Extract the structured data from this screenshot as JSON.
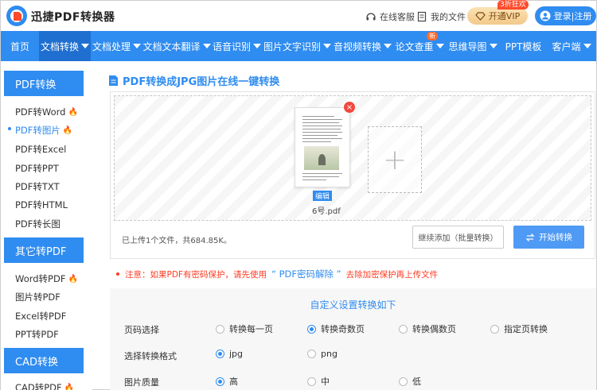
{
  "header": {
    "brand": "迅捷PDF转换器",
    "service_label": "在线客服",
    "files_label": "我的文件",
    "vip_label": "开通VIP",
    "vip_badge": "3折狂欢",
    "login_label": "登录|注册"
  },
  "nav": {
    "items": [
      {
        "label": "首页",
        "dropdown": false
      },
      {
        "label": "文档转换",
        "dropdown": true,
        "active": true
      },
      {
        "label": "文档处理",
        "dropdown": true
      },
      {
        "label": "文档文本翻译",
        "dropdown": true
      },
      {
        "label": "语音识别",
        "dropdown": true
      },
      {
        "label": "图片文字识别",
        "dropdown": true
      },
      {
        "label": "音视频转换",
        "dropdown": true
      },
      {
        "label": "论文查重",
        "dropdown": true,
        "badge": "新"
      },
      {
        "label": "思维导图",
        "dropdown": true
      },
      {
        "label": "PPT模板",
        "dropdown": false
      },
      {
        "label": "客户端",
        "dropdown": true
      }
    ]
  },
  "sidebar": {
    "section1": {
      "title": "PDF转换",
      "items": [
        {
          "label": "PDF转Word",
          "hot": true
        },
        {
          "label": "PDF转图片",
          "hot": true,
          "active": true
        },
        {
          "label": "PDF转Excel"
        },
        {
          "label": "PDF转PPT"
        },
        {
          "label": "PDF转TXT"
        },
        {
          "label": "PDF转HTML"
        },
        {
          "label": "PDF转长图"
        }
      ]
    },
    "section2": {
      "title": "其它转PDF",
      "items": [
        {
          "label": "Word转PDF",
          "hot": true
        },
        {
          "label": "图片转PDF"
        },
        {
          "label": "Excel转PDF"
        },
        {
          "label": "PPT转PDF"
        }
      ]
    },
    "section3": {
      "title": "CAD转换",
      "items": [
        {
          "label": "CAD转PDF",
          "hot": true
        }
      ]
    }
  },
  "main": {
    "title": "PDF转换成JPG图片在线一键转换",
    "file": {
      "name": "6号.pdf",
      "edit_label": "编辑",
      "close_glyph": "×"
    },
    "add_glyph": "+",
    "upload_info": "已上传1个文件，共684.85K。",
    "continue_label": "继续添加（批量转换）",
    "start_label": "开始转换"
  },
  "notice": {
    "prefix": "注意：如果PDF有密码保护，请先使用",
    "link": "“ PDF密码解除 ”",
    "suffix": "去除加密保护再上传文件"
  },
  "settings": {
    "title": "自定义设置转换如下",
    "rows": [
      {
        "label": "页码选择",
        "options": [
          {
            "label": "转换每一页",
            "checked": false
          },
          {
            "label": "转换奇数页",
            "checked": true
          },
          {
            "label": "转换偶数页",
            "checked": false
          },
          {
            "label": "指定页转换",
            "checked": false
          }
        ]
      },
      {
        "label": "选择转换格式",
        "options": [
          {
            "label": "jpg",
            "checked": true
          },
          {
            "label": "png",
            "checked": false
          }
        ]
      },
      {
        "label": "图片质量",
        "options": [
          {
            "label": "高",
            "checked": true
          },
          {
            "label": "中",
            "checked": false
          },
          {
            "label": "低",
            "checked": false
          }
        ]
      }
    ]
  },
  "colors": {
    "primary": "#2f8cf0",
    "nav_active": "#1f6fd0",
    "notice": "#ff3b22",
    "hot": "#ff6a2b"
  },
  "icons": [
    "logo-icon",
    "headset-icon",
    "file-icon",
    "diamond-icon",
    "user-icon",
    "fire-icon",
    "doc-title-icon",
    "close-icon",
    "plus-icon",
    "convert-icon"
  ]
}
